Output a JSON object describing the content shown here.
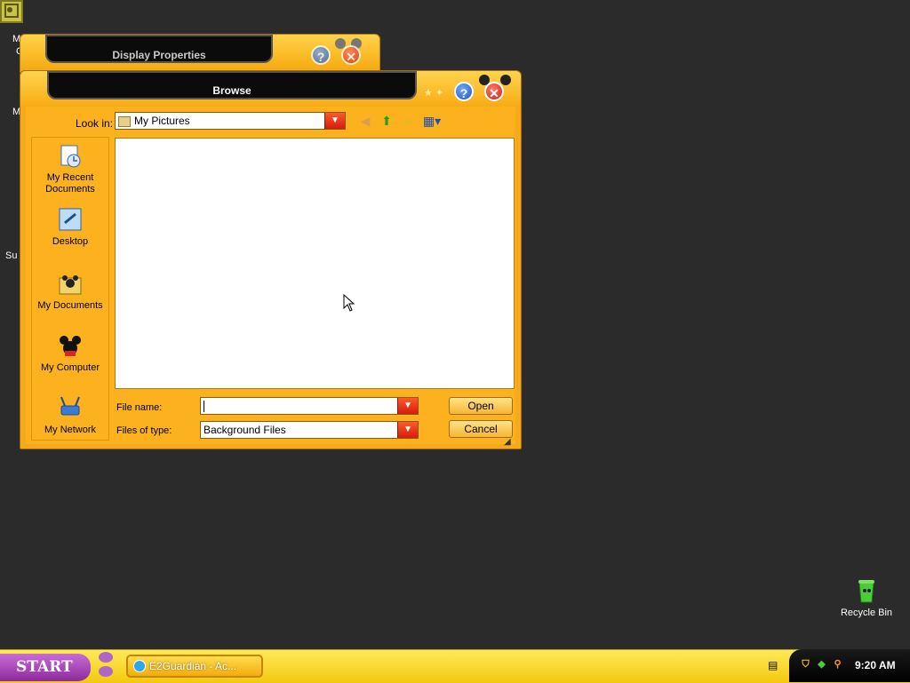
{
  "desktop": {
    "left_fragments": [
      "M",
      "C",
      "M",
      "Su"
    ],
    "recycle_bin_label": "Recycle Bin"
  },
  "background_window": {
    "title": "Display Properties"
  },
  "dialog": {
    "title": "Browse",
    "look_in_label": "Look in:",
    "look_in_value": "My Pictures",
    "places": [
      {
        "label": "My Recent Documents",
        "icon": "recent-documents-icon"
      },
      {
        "label": "Desktop",
        "icon": "desktop-icon"
      },
      {
        "label": "My Documents",
        "icon": "my-documents-icon"
      },
      {
        "label": "My Computer",
        "icon": "my-computer-icon"
      },
      {
        "label": "My Network",
        "icon": "my-network-icon"
      }
    ],
    "file_name_label": "File name:",
    "file_name_value": "",
    "files_of_type_label": "Files of type:",
    "files_of_type_value": "Background Files",
    "open_label": "Open",
    "cancel_label": "Cancel"
  },
  "taskbar": {
    "start_label": "START",
    "task_label": "E2Guardian - Ac...",
    "clock": "9:20 AM"
  }
}
